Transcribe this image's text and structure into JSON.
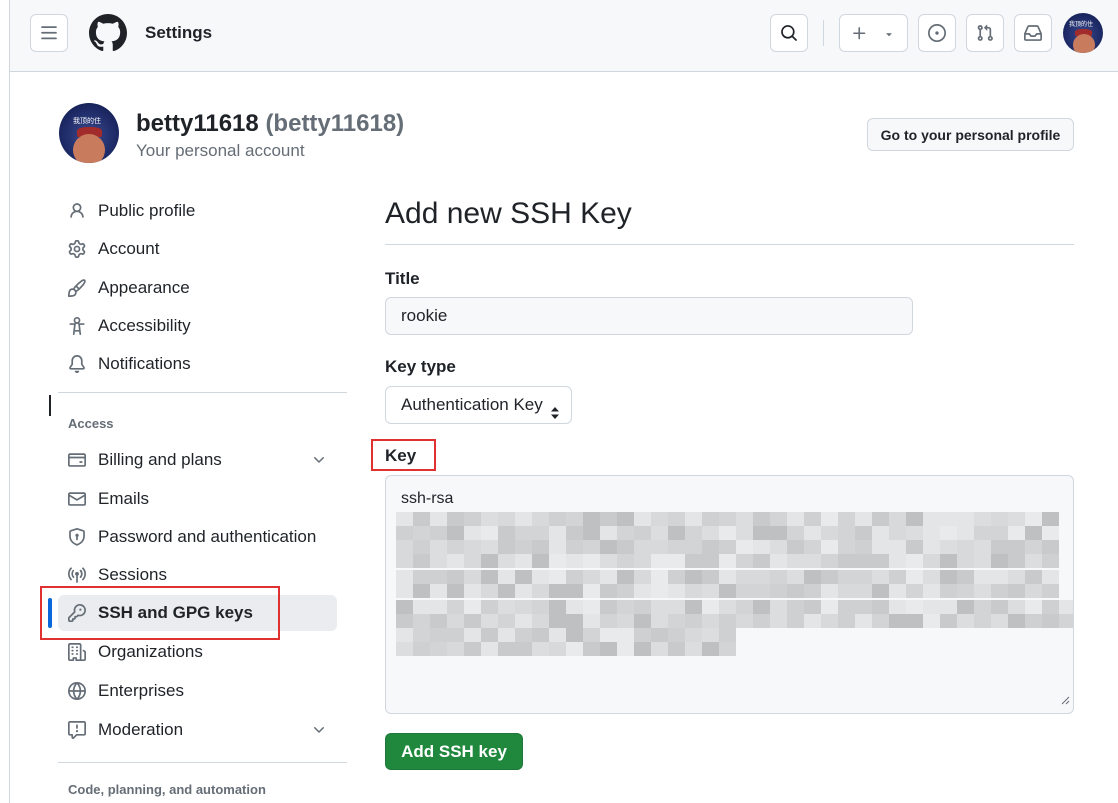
{
  "header": {
    "context": "Settings",
    "menu_icon": "hamburger-icon",
    "search_icon": "search-icon",
    "create_icon": "plus-icon",
    "issues_icon": "issue-opened-icon",
    "pulls_icon": "git-pull-request-icon",
    "inbox_icon": "inbox-icon"
  },
  "avatar_text": "我顶的住",
  "profile": {
    "name": "betty11618",
    "login": "(betty11618)",
    "caption": "Your personal account",
    "profile_button": "Go to your personal profile"
  },
  "sidebar": {
    "items": [
      {
        "label": "Public profile",
        "icon": "person-icon"
      },
      {
        "label": "Account",
        "icon": "gear-icon"
      },
      {
        "label": "Appearance",
        "icon": "paintbrush-icon"
      },
      {
        "label": "Accessibility",
        "icon": "accessibility-icon"
      },
      {
        "label": "Notifications",
        "icon": "bell-icon"
      }
    ],
    "access_section": "Access",
    "access_items": [
      {
        "label": "Billing and plans",
        "icon": "credit-card-icon"
      },
      {
        "label": "Emails",
        "icon": "mail-icon"
      },
      {
        "label": "Password and authentication",
        "icon": "shield-lock-icon"
      },
      {
        "label": "Sessions",
        "icon": "broadcast-icon"
      },
      {
        "label": "SSH and GPG keys",
        "icon": "key-icon"
      },
      {
        "label": "Organizations",
        "icon": "organization-icon"
      },
      {
        "label": "Enterprises",
        "icon": "globe-icon"
      },
      {
        "label": "Moderation",
        "icon": "report-icon"
      }
    ],
    "code_section": "Code, planning, and automation"
  },
  "main": {
    "heading": "Add new SSH Key",
    "title_label": "Title",
    "title_value": "rookie",
    "keytype_label": "Key type",
    "keytype_value": "Authentication Key",
    "key_label": "Key",
    "key_value_visible": "ssh-rsa",
    "submit_label": "Add SSH key"
  },
  "colors": {
    "accent": "#0969da",
    "primary_button": "#1f883d",
    "highlight_box": "#e03131",
    "header_bg": "#f6f8fa"
  }
}
